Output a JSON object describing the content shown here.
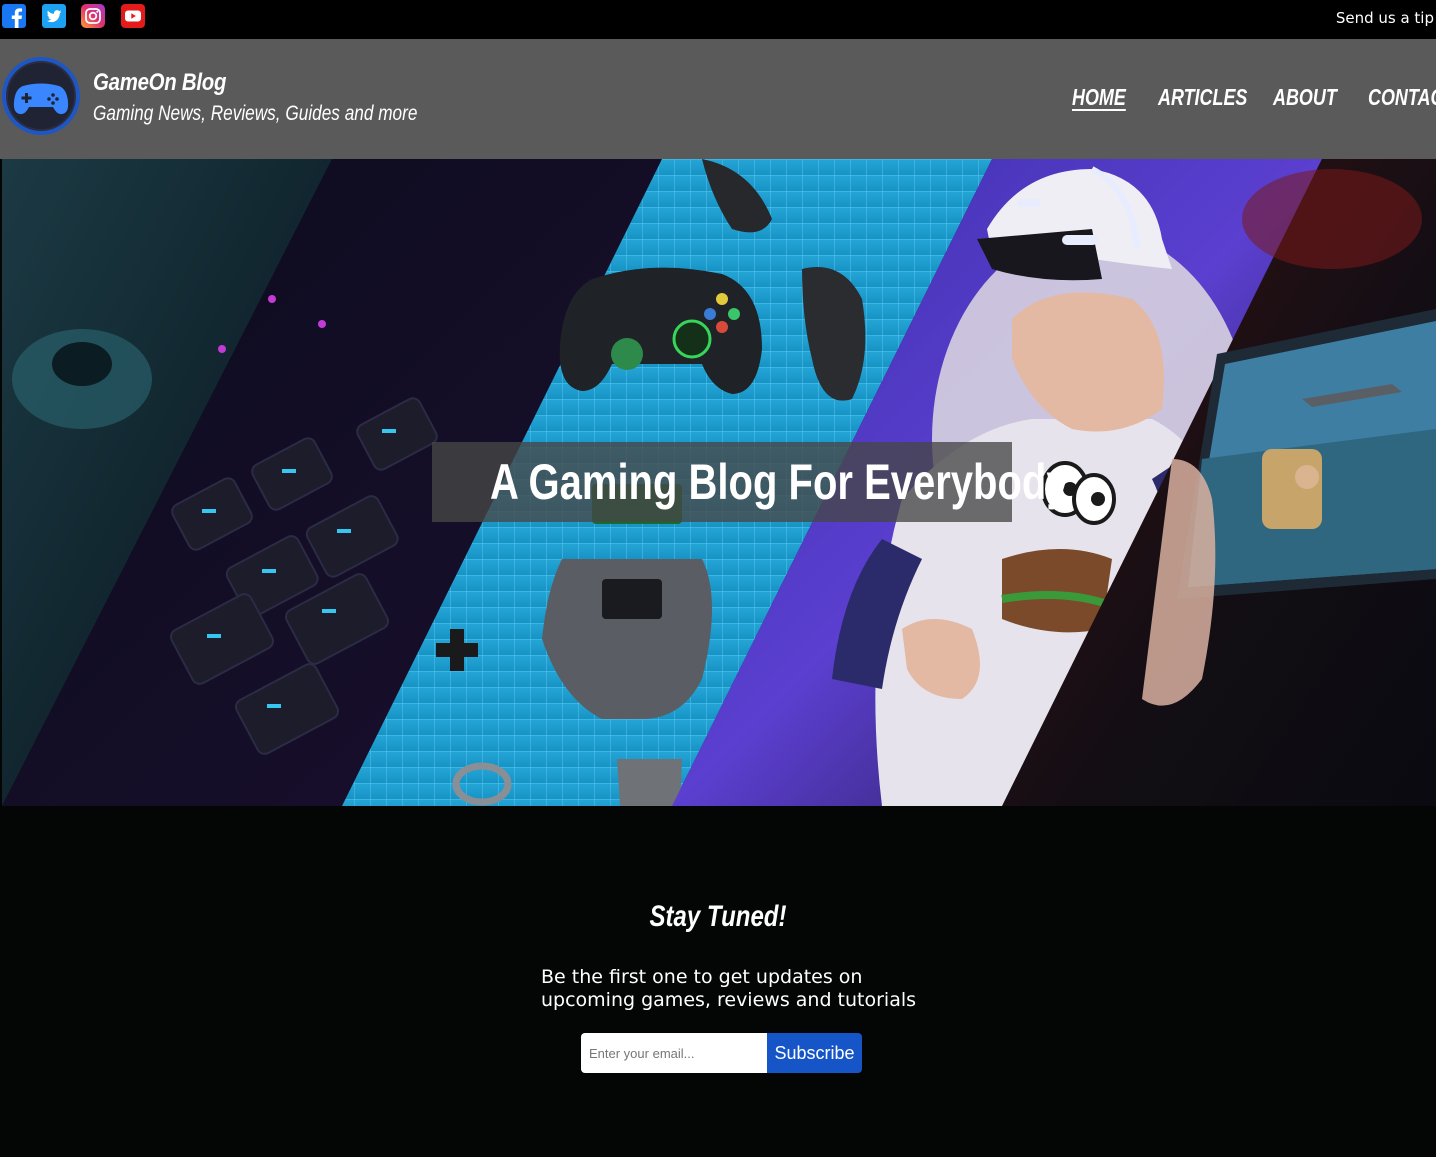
{
  "topbar": {
    "social": [
      {
        "icon": "facebook-icon",
        "color": "#1877f2"
      },
      {
        "icon": "twitter-icon",
        "color": "#1da1f2"
      },
      {
        "icon": "instagram-icon",
        "color": "#e1306c"
      },
      {
        "icon": "youtube-icon",
        "color": "#ff0000"
      }
    ],
    "tip_link": "Send us a tip"
  },
  "header": {
    "logo_icon": "gamepad-icon",
    "brand_name": "GameOn Blog",
    "tagline": "Gaming News, Reviews, Guides and more",
    "nav": [
      {
        "label": "HOME",
        "active": true
      },
      {
        "label": "ARTICLES",
        "active": false
      },
      {
        "label": "ABOUT",
        "active": false
      },
      {
        "label": "CONTACT",
        "active": false
      }
    ]
  },
  "hero": {
    "title": "A Gaming Blog For Everybody"
  },
  "newsletter": {
    "title": "Stay Tuned!",
    "text": "Be the first one to get updates on upcoming games, reviews and tutorials",
    "email_placeholder": "Enter your email...",
    "subscribe_label": "Subscribe"
  },
  "colors": {
    "topbar_bg": "#000000",
    "header_bg": "#5a5a5a",
    "page_bg": "#030604",
    "accent_blue": "#1655c8"
  }
}
